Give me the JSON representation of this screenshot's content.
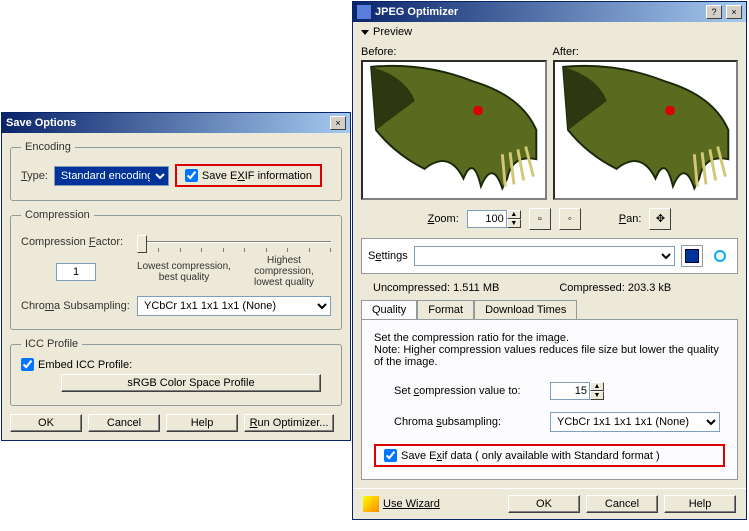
{
  "saveOptions": {
    "title": "Save Options",
    "encoding": {
      "legend": "Encoding",
      "typeLabel": "Type:",
      "typeValue": "Standard encoding",
      "saveExif": "Save EXIF information"
    },
    "compression": {
      "legend": "Compression",
      "factorLabel": "Compression Factor:",
      "factorValue": "1",
      "lowest": "Lowest compression,\nbest quality",
      "highest": "Highest compression,\nlowest quality",
      "chromaLabel": "Chroma Subsampling:",
      "chromaValue": "YCbCr  1x1  1x1  1x1  (None)"
    },
    "icc": {
      "legend": "ICC Profile",
      "embedLabel": "Embed ICC Profile:",
      "profileValue": "sRGB Color Space Profile"
    },
    "buttons": {
      "ok": "OK",
      "cancel": "Cancel",
      "help": "Help",
      "run": "Run Optimizer..."
    }
  },
  "optimizer": {
    "title": "JPEG Optimizer",
    "previewToggle": "Preview",
    "before": "Before:",
    "after": "After:",
    "zoomLabel": "Zoom:",
    "zoomValue": "100",
    "panLabel": "Pan:",
    "settingsLabel": "Settings",
    "uncompressedLabel": "Uncompressed:  1.511 MB",
    "compressedLabel": "Compressed:  203.3 kB",
    "tabs": {
      "quality": "Quality",
      "format": "Format",
      "download": "Download Times"
    },
    "panel": {
      "intro1": "Set the compression ratio for the image.",
      "intro2": "Note:  Higher compression values reduces file size but lower the quality of the image.",
      "compLabel": "Set compression value to:",
      "compValue": "15",
      "chromaLabel": "Chroma subsampling:",
      "chromaValue": "YCbCr  1x1  1x1  1x1  (None)",
      "saveExif": "Save Exif data ( only available with Standard format )"
    },
    "bottom": {
      "wizard": "Use Wizard",
      "ok": "OK",
      "cancel": "Cancel",
      "help": "Help"
    }
  }
}
